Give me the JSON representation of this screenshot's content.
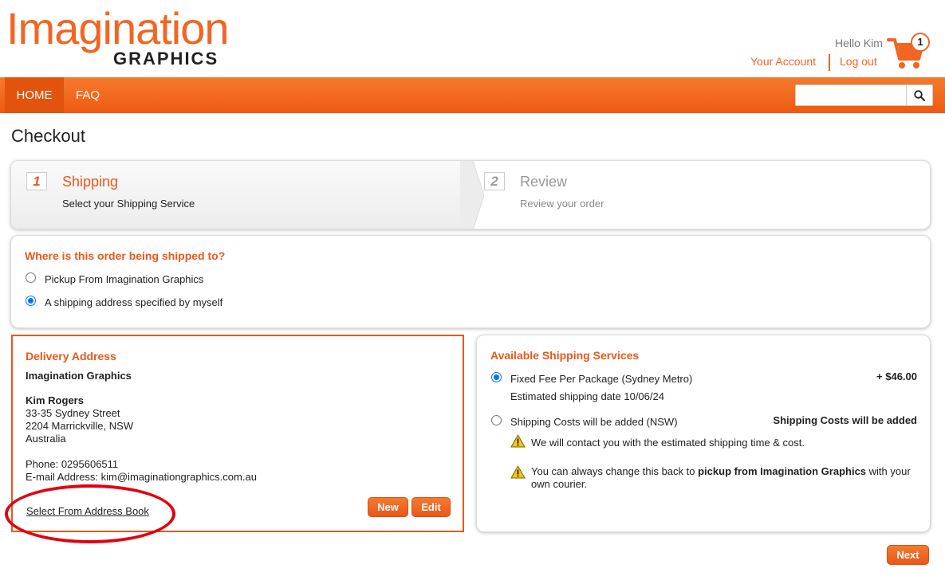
{
  "header": {
    "logo_main": "Imagination",
    "logo_sub": "GRAPHICS",
    "greeting": "Hello Kim",
    "account_link": "Your Account",
    "logout_link": "Log out",
    "cart_count": "1"
  },
  "nav": {
    "items": [
      {
        "label": "HOME"
      },
      {
        "label": "FAQ"
      }
    ],
    "search": {
      "value": "",
      "placeholder": ""
    }
  },
  "page": {
    "title": "Checkout"
  },
  "steps": [
    {
      "number": "1",
      "title": "Shipping",
      "subtitle": "Select your Shipping Service",
      "active": true
    },
    {
      "number": "2",
      "title": "Review",
      "subtitle": "Review your order",
      "active": false
    }
  ],
  "ship_to": {
    "question": "Where is this order being shipped to?",
    "options": [
      {
        "label": "Pickup From Imagination Graphics",
        "checked": false
      },
      {
        "label": "A shipping address specified by myself",
        "checked": true
      }
    ]
  },
  "delivery": {
    "title": "Delivery Address",
    "company": "Imagination Graphics",
    "name": "Kim Rogers",
    "street": "33-35 Sydney Street",
    "city": "2204 Marrickville, NSW",
    "country": "Australia",
    "phone": "Phone: 0295606511",
    "email": "E-mail Address: kim@imaginationgraphics.com.au",
    "address_book_link": "Select From Address Book",
    "new_label": "New",
    "edit_label": "Edit"
  },
  "services": {
    "title": "Available Shipping Services",
    "options": [
      {
        "label": "Fixed Fee Per Package (Sydney Metro)",
        "sub": "Estimated shipping date 10/06/24",
        "price": "+ $46.00",
        "checked": true
      },
      {
        "label": "Shipping Costs will be added (NSW)",
        "price": "Shipping Costs will be added",
        "checked": false
      }
    ],
    "note1": "We will contact you with the estimated shipping time & cost.",
    "note2_pre": "You can always change this back to ",
    "note2_bold": "pickup from Imagination Graphics",
    "note2_post": " with your",
    "note2_line2": "own courier."
  },
  "footer": {
    "next_label": "Next"
  },
  "colors": {
    "brand_orange": "#f26522",
    "title_orange": "#e9591a",
    "radio_blue": "#0075ff",
    "highlight_red": "#e3000f"
  },
  "icons": [
    "cart-icon",
    "search-icon",
    "warning-icon"
  ]
}
